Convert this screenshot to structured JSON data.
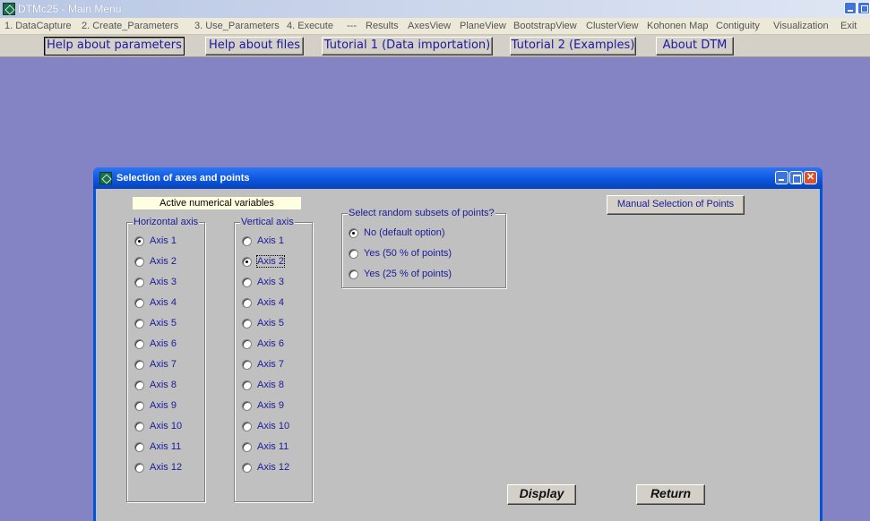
{
  "app": {
    "title": "DTMc25 - Main Menu"
  },
  "menu": [
    {
      "label": "1. DataCapture"
    },
    {
      "label": "2. Create_Parameters"
    },
    {
      "label": "3. Use_Parameters"
    },
    {
      "label": "4. Execute"
    },
    {
      "label": "---"
    },
    {
      "label": "Results"
    },
    {
      "label": "AxesView"
    },
    {
      "label": "PlaneView"
    },
    {
      "label": "BootstrapView"
    },
    {
      "label": "ClusterView"
    },
    {
      "label": "Kohonen Map"
    },
    {
      "label": "Contiguity"
    },
    {
      "label": "Visualization"
    },
    {
      "label": "Exit"
    }
  ],
  "help_buttons": [
    {
      "label": "Help about parameters"
    },
    {
      "label": "Help about files"
    },
    {
      "label": "Tutorial 1 (Data  importation)"
    },
    {
      "label": "Tutorial 2  (Examples)"
    },
    {
      "label": "About DTM"
    }
  ],
  "dialog": {
    "title": "Selection of axes and points",
    "active_label": "Active  numerical  variables",
    "manual_button": "Manual Selection of Points",
    "horizontal": {
      "title": "Horizontal axis",
      "selected": "Axis 1",
      "options": [
        "Axis 1",
        "Axis 2",
        "Axis 3",
        "Axis 4",
        "Axis 5",
        "Axis 6",
        "Axis 7",
        "Axis 8",
        "Axis 9",
        "Axis 10",
        "Axis 11",
        "Axis 12"
      ]
    },
    "vertical": {
      "title": "Vertical axis",
      "selected": "Axis 2",
      "options": [
        "Axis 1",
        "Axis 2",
        "Axis 3",
        "Axis 4",
        "Axis 5",
        "Axis 6",
        "Axis 7",
        "Axis 8",
        "Axis 9",
        "Axis 10",
        "Axis 11",
        "Axis 12"
      ]
    },
    "random": {
      "title": "Select random subsets of points?",
      "selected": "No (default option)",
      "options": [
        "No (default option)",
        "Yes  (50 % of points)",
        "Yes (25 % of points)"
      ]
    },
    "display_button": "Display",
    "return_button": "Return"
  }
}
